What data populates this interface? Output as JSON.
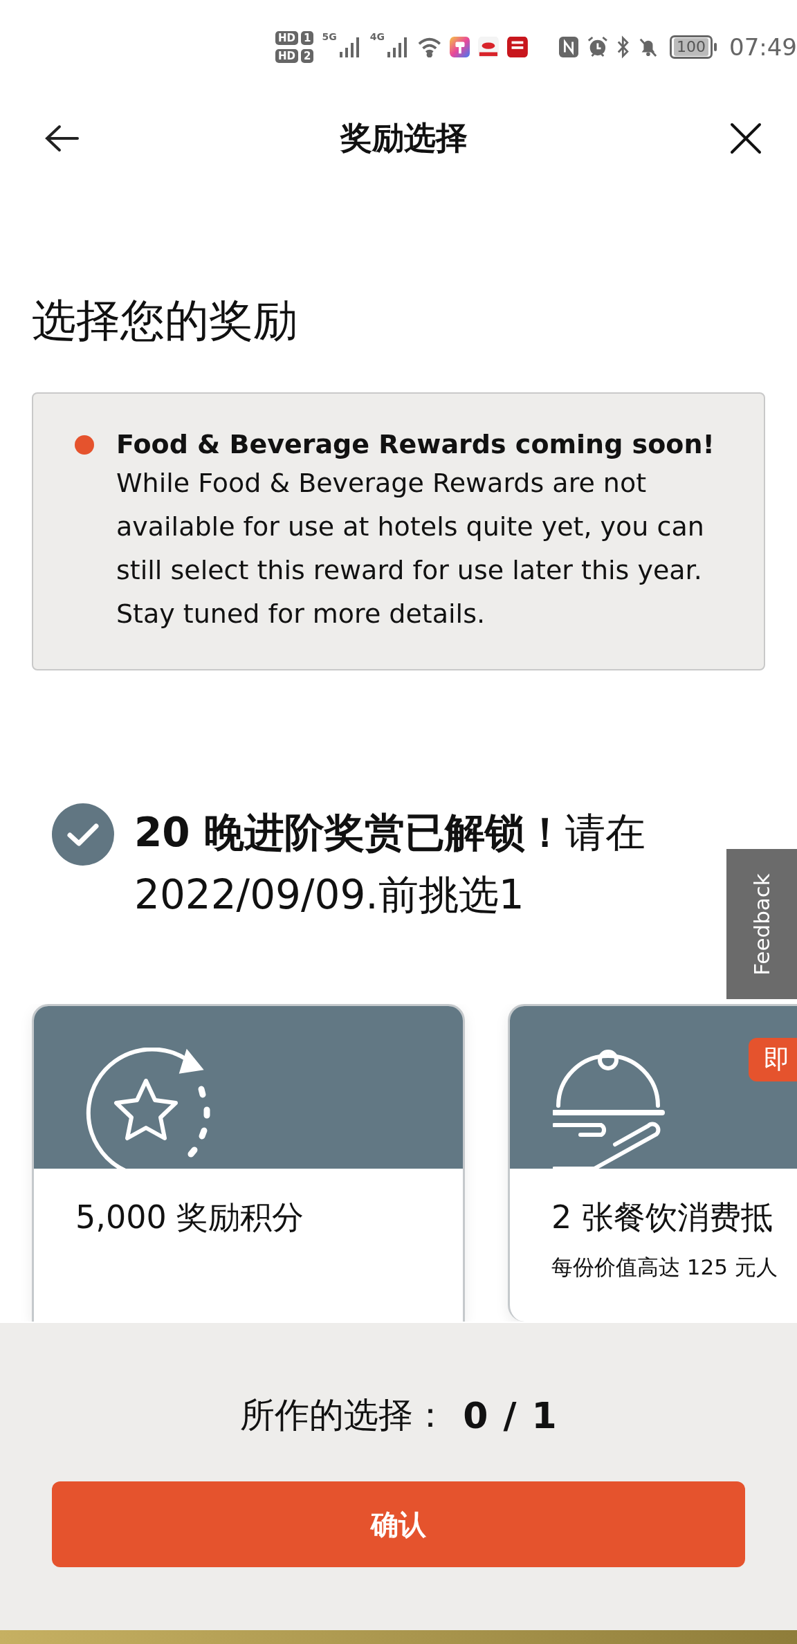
{
  "status_bar": {
    "sims": [
      {
        "label": "HD",
        "slot": "1"
      },
      {
        "label": "HD",
        "slot": "2"
      }
    ],
    "networks": [
      "5G",
      "4G"
    ],
    "battery": "100",
    "time": "07:49"
  },
  "header": {
    "title": "奖励选择"
  },
  "heading": "选择您的奖励",
  "notice": {
    "color": "#e5532d",
    "title": "Food & Beverage Rewards coming soon!",
    "body": "While Food & Beverage Rewards are not available for use at hotels quite yet, you can still select this reward for use later this year. Stay tuned for more details."
  },
  "milestone": {
    "completed": true,
    "text": "**20 晚进阶奖赏已解锁！**请在 2022/09/09.前挑选1"
  },
  "feedback": "Feedback",
  "rewards": [
    {
      "kind": "points",
      "title": "5,000 奖励积分"
    },
    {
      "kind": "dining",
      "title": "2 张餐饮消费抵",
      "subtitle": "每份价值高达 125 元人",
      "badge": "即"
    }
  ],
  "footer": {
    "label": "所作的选择：",
    "count": "0",
    "separator": "/",
    "total": "1",
    "button": "确认"
  }
}
